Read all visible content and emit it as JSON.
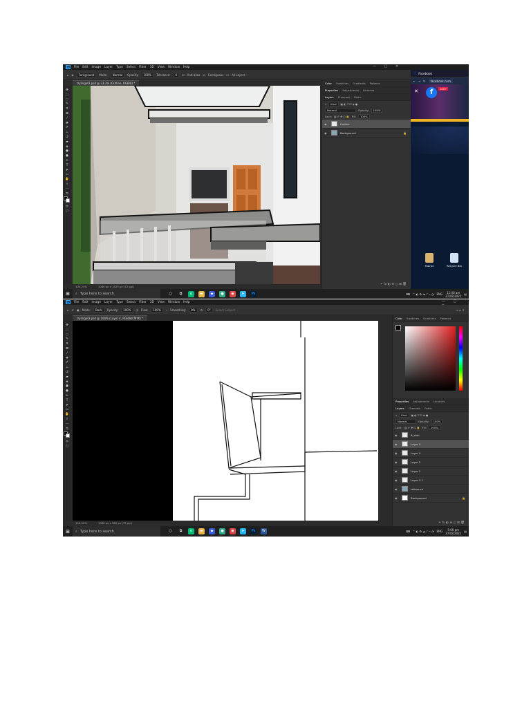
{
  "screen1": {
    "menu": [
      "File",
      "Edit",
      "Image",
      "Layer",
      "Type",
      "Select",
      "Filter",
      "3D",
      "View",
      "Window",
      "Help"
    ],
    "options": {
      "sample": "Foreground",
      "mode_label": "Mode:",
      "mode": "Normal",
      "opacity_label": "Opacity:",
      "opacity": "100%",
      "tolerance_label": "Tolerance:",
      "tolerance": "0",
      "antialias": "Anti-alias",
      "contiguous": "Contiguous",
      "all_layers": "All Layers"
    },
    "doc_tab": "trylinget3.psd @ 33.3% (Outline, RGB/8) *",
    "status": {
      "zoom": "100.24%",
      "doc": "1080 px x 1025 px (72 ppi)"
    },
    "panel_top_tabs": [
      "Color",
      "Swatches",
      "Gradients",
      "Patterns"
    ],
    "panel_mid_tabs": [
      "Properties",
      "Adjustments",
      "Libraries"
    ],
    "layers_tabs": [
      "Layers",
      "Channels",
      "Paths"
    ],
    "kind": "Kind",
    "blend": "Normal",
    "opacity_label": "Opacity:",
    "opacity": "100%",
    "lock_label": "Lock:",
    "fill_label": "Fill:",
    "fill": "100%",
    "layers": [
      {
        "name": "Outline",
        "selected": true
      },
      {
        "name": "Background",
        "selected": false
      }
    ],
    "facebook": {
      "tab_title": "Facebook",
      "url": "facebook.com",
      "badge": "100+",
      "icons": [
        {
          "label": "Trainer",
          "icon": "folder-icon"
        },
        {
          "label": "Recycle Bin",
          "icon": "recycle-bin-icon"
        }
      ]
    },
    "taskbar": {
      "search_placeholder": "Type here to search",
      "lang": "ENG",
      "time": "11:40 am",
      "date": "27/02/2022"
    }
  },
  "screen2": {
    "menu": [
      "File",
      "Edit",
      "Image",
      "Layer",
      "Type",
      "Select",
      "Filter",
      "3D",
      "View",
      "Window",
      "Help"
    ],
    "options": {
      "mode_label": "Mode:",
      "mode": "Back",
      "opacity_label": "Opacity:",
      "opacity": "100%",
      "flow_label": "Flow:",
      "flow": "100%",
      "smoothing_label": "Smoothing:",
      "smoothing": "0%",
      "angle": "0°",
      "select_subject": "Select Subject"
    },
    "doc_tab": "trylinget3.psd @ 100% (Layer 4, RGB/8/CMYK) *",
    "status": {
      "zoom": "100.00%",
      "doc": "1080 px x 960 px (72 ppi)"
    },
    "panel_top_tabs": [
      "Color",
      "Swatches",
      "Gradients",
      "Patterns"
    ],
    "panel_mid_tabs": [
      "Properties",
      "Adjustments",
      "Libraries"
    ],
    "layers_tabs": [
      "Layers",
      "Channels",
      "Paths"
    ],
    "kind": "Kind",
    "blend": "Normal",
    "opacity_label": "Opacity:",
    "opacity": "100%",
    "lock_label": "Lock:",
    "fill_label": "Fill:",
    "fill": "100%",
    "layers": [
      {
        "name": "B_stair",
        "selected": false
      },
      {
        "name": "Layer 4",
        "selected": true
      },
      {
        "name": "Layer 3",
        "selected": false
      },
      {
        "name": "Layer 2",
        "selected": false
      },
      {
        "name": "Layer 1",
        "selected": false
      },
      {
        "name": "Layer 1.1",
        "selected": false
      },
      {
        "name": "reference",
        "selected": false
      },
      {
        "name": "Background",
        "selected": false
      }
    ],
    "taskbar": {
      "search_placeholder": "Type here to search",
      "lang": "ENG",
      "time": "5:00 pm",
      "date": "27/02/2022"
    }
  },
  "colors": {
    "ps_bg": "#2b2b2b",
    "ps_panel": "#323232",
    "fb_blue": "#1877f2",
    "selected_layer": "#525252"
  }
}
